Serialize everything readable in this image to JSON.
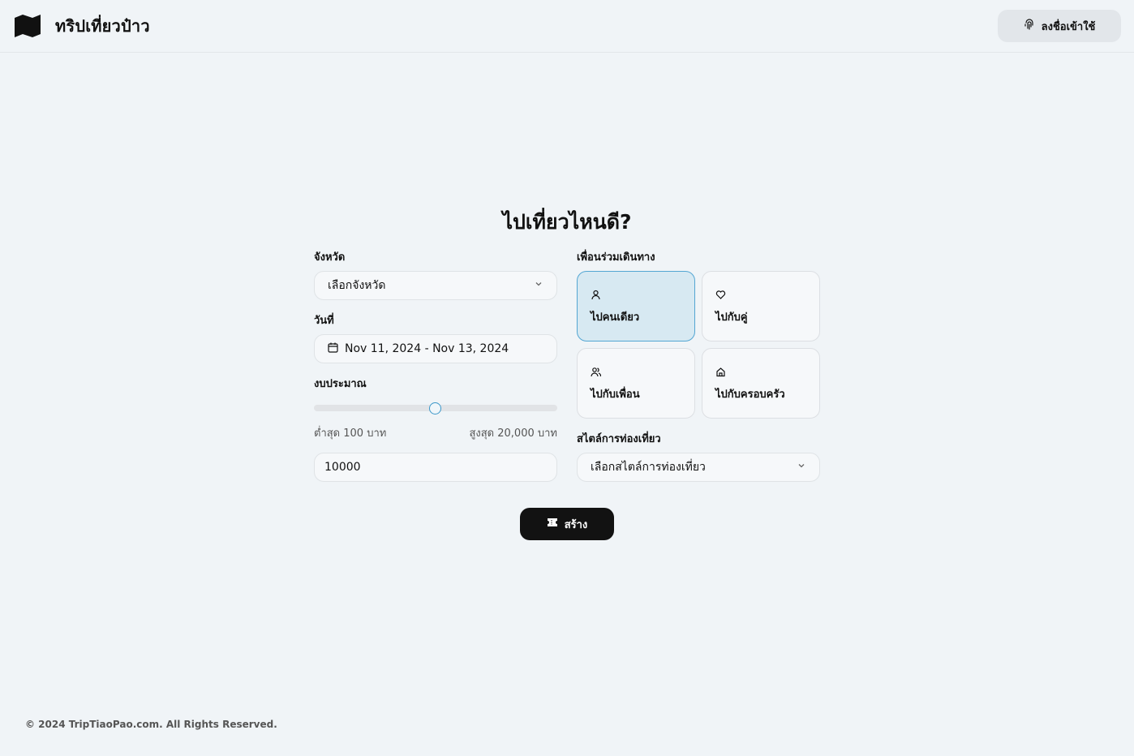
{
  "header": {
    "brand_name": "ทริปเที่ยวป๋าว",
    "login_label": "ลงชื่อเข้าใช้"
  },
  "form": {
    "title": "ไปเที่ยวไหนดี?",
    "province": {
      "label": "จังหวัด",
      "selected": "เลือกจังหวัด"
    },
    "date": {
      "label": "วันที่",
      "value": "Nov 11, 2024 - Nov 13, 2024"
    },
    "budget": {
      "label": "งบประมาณ",
      "min_label": "ต่ำสุด 100 บาท",
      "max_label": "สูงสุด 20,000 บาท",
      "min": 100,
      "max": 20000,
      "value": "10000",
      "slider_value": 10000
    },
    "companions": {
      "label": "เพื่อนร่วมเดินทาง",
      "options": [
        {
          "label": "ไปคนเดียว",
          "icon": "user-icon",
          "selected": true
        },
        {
          "label": "ไปกับคู่",
          "icon": "heart-icon",
          "selected": false
        },
        {
          "label": "ไปกับเพื่อน",
          "icon": "users-icon",
          "selected": false
        },
        {
          "label": "ไปกับครอบครัว",
          "icon": "home-icon",
          "selected": false
        }
      ]
    },
    "style": {
      "label": "สไตล์การท่องเที่ยว",
      "selected": "เลือกสไตล์การท่องเที่ยว"
    },
    "create_label": "สร้าง"
  },
  "footer": {
    "copyright": "© 2024 TripTiaoPao.com. All Rights Reserved."
  },
  "colors": {
    "background": "#f0f4f7",
    "accent": "#3b97c9",
    "selected_card_bg": "#d7e9f2",
    "primary_button": "#121212"
  }
}
